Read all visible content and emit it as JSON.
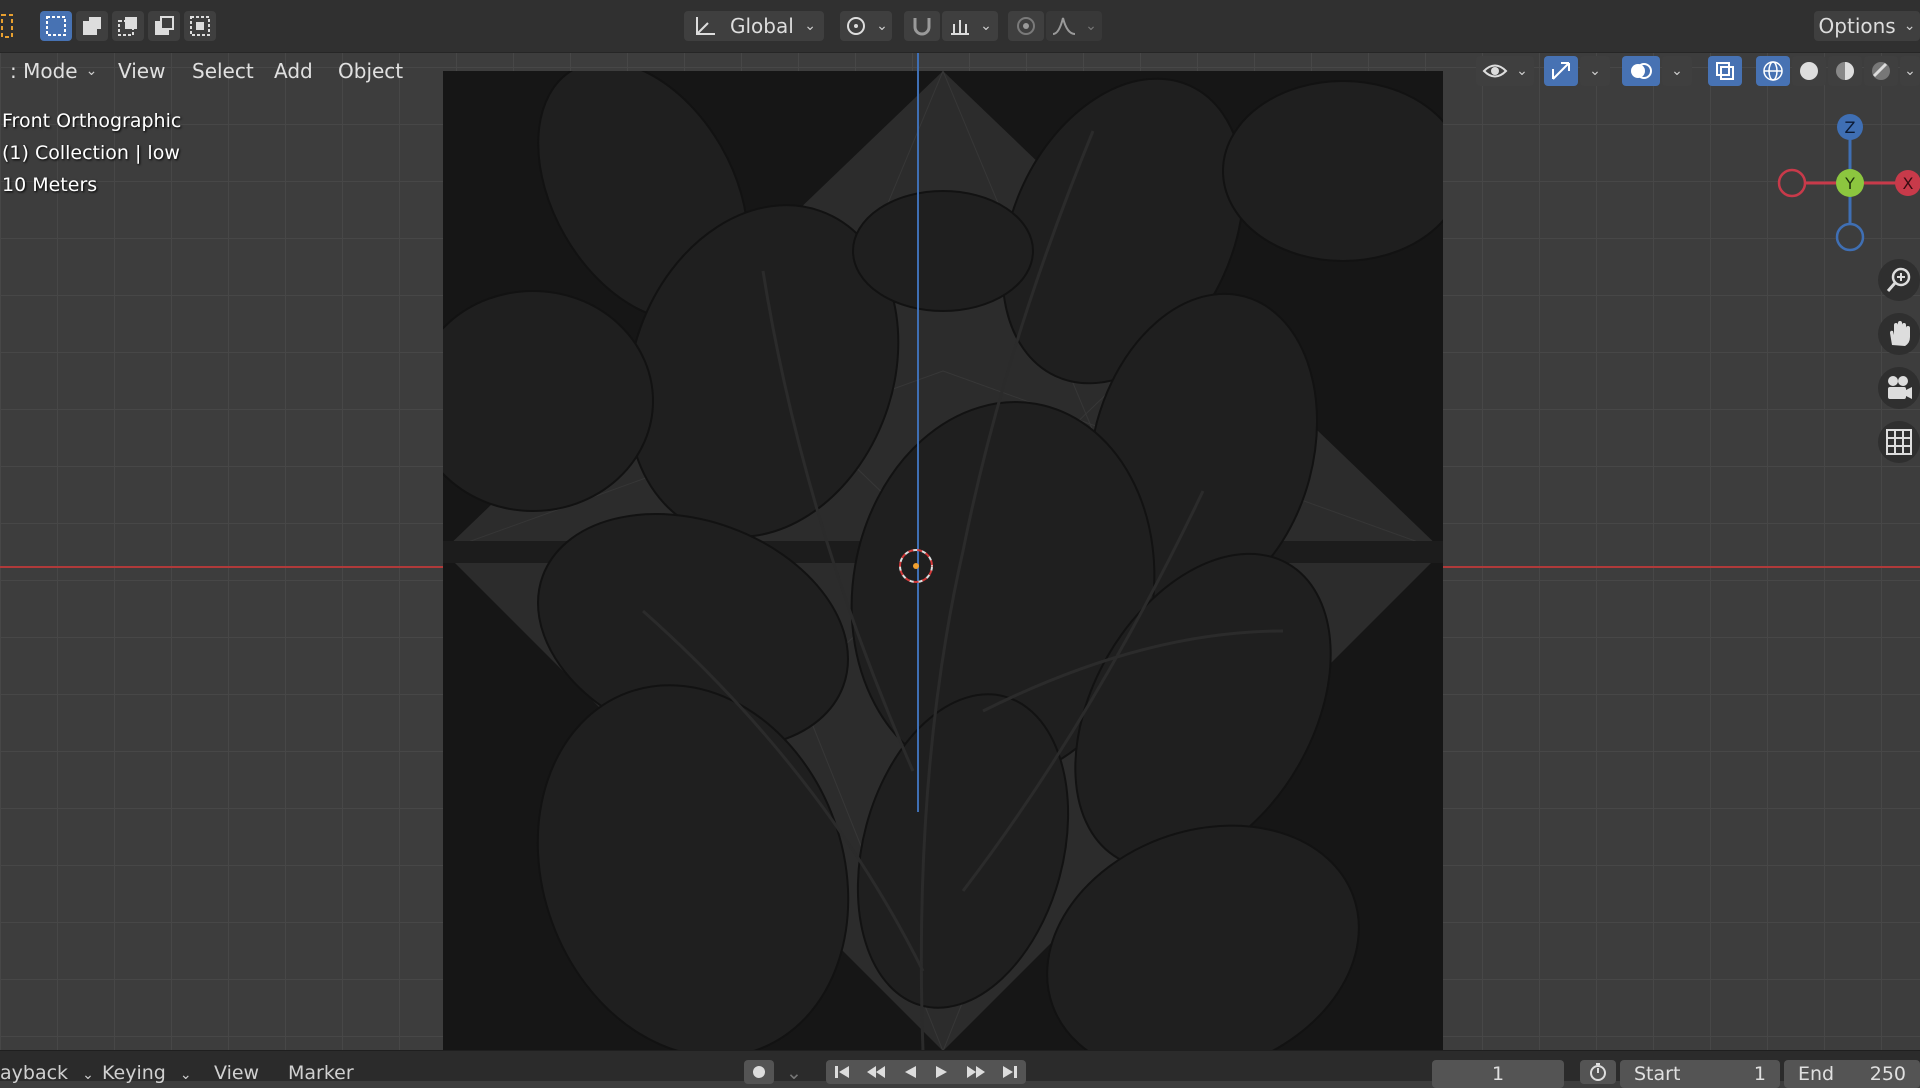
{
  "header": {
    "transform_orientation": "Global",
    "options_label": "Options"
  },
  "menubar": {
    "mode_label": ": Mode",
    "view": "View",
    "select": "Select",
    "add": "Add",
    "object": "Object"
  },
  "viewport": {
    "view_name": "Front Orthographic",
    "collection_info": "(1) Collection | low",
    "scale": "10 Meters"
  },
  "gizmo": {
    "z": "Z",
    "y": "Y",
    "x": "X"
  },
  "timeline": {
    "playback": "ayback",
    "keying": "Keying",
    "view": "View",
    "marker": "Marker",
    "current_frame": "1",
    "start_label": "Start",
    "start_value": "1",
    "end_label": "End",
    "end_value": "250"
  },
  "colors": {
    "accent": "#4772b3",
    "axis_x": "#b03a3a",
    "axis_z": "#3f6fb4",
    "gizmo_y": "#8cc63f"
  }
}
